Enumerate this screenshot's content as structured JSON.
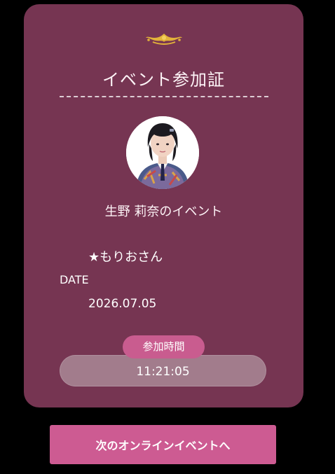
{
  "card": {
    "title": "イベント参加証",
    "event_name": "生野 莉奈のイベント",
    "nickname": "★もりおさん",
    "date_label": "DATE",
    "date_value": "2026.07.05",
    "time_label": "参加時間",
    "time_value": "11:21:05",
    "ornament_icon": "gold-crown-ornament-icon",
    "avatar_icon": "member-photo"
  },
  "next_button": {
    "label": "次のオンラインイベントへ"
  },
  "colors": {
    "background": "#000000",
    "card": "#763552",
    "accent_pink": "#cd5b92",
    "ornament_gold": "#e2b23a",
    "time_bar": "#a27c8c"
  }
}
